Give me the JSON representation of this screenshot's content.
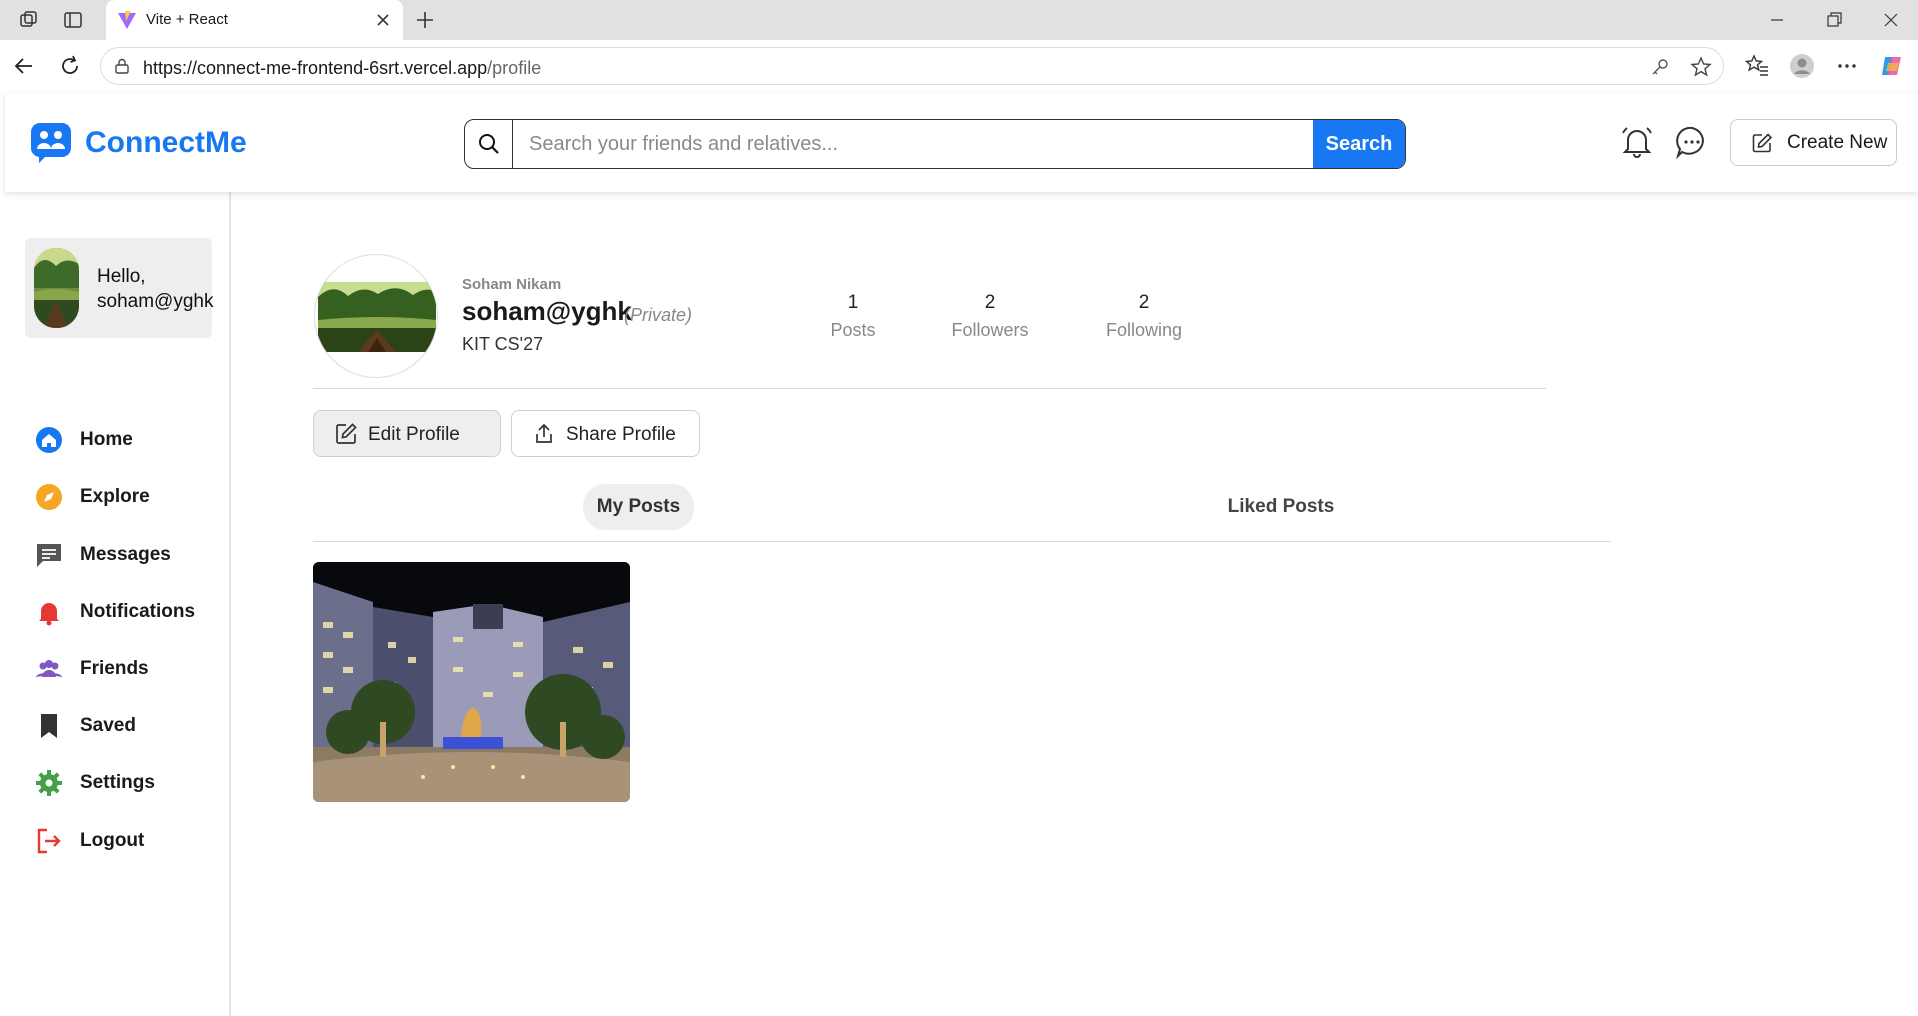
{
  "browser": {
    "tab_title": "Vite + React",
    "url_host": "https://connect-me-frontend-6srt.vercel.app",
    "url_path": "/profile"
  },
  "app": {
    "brand": "ConnectMe",
    "brand_color": "#1877f2",
    "search": {
      "placeholder": "Search your friends and relatives...",
      "button_label": "Search"
    },
    "create_label": "Create New"
  },
  "sidebar": {
    "greeting": "Hello,",
    "user_handle": "soham@yghk",
    "items": [
      {
        "label": "Home",
        "icon": "home-icon",
        "color": "#1877f2"
      },
      {
        "label": "Explore",
        "icon": "compass-icon",
        "color": "#f5a623"
      },
      {
        "label": "Messages",
        "icon": "message-icon",
        "color": "#555555"
      },
      {
        "label": "Notifications",
        "icon": "bell-icon",
        "color": "#e53935"
      },
      {
        "label": "Friends",
        "icon": "friends-icon",
        "color": "#7e57c2"
      },
      {
        "label": "Saved",
        "icon": "bookmark-icon",
        "color": "#333333"
      },
      {
        "label": "Settings",
        "icon": "gear-icon",
        "color": "#43a047"
      },
      {
        "label": "Logout",
        "icon": "logout-icon",
        "color": "#e53935"
      }
    ]
  },
  "profile": {
    "full_name": "Soham Nikam",
    "username": "soham@yghk",
    "privacy": "(Private)",
    "bio": "KIT CS'27",
    "stats": [
      {
        "value": "1",
        "label": "Posts"
      },
      {
        "value": "2",
        "label": "Followers"
      },
      {
        "value": "2",
        "label": "Following"
      }
    ],
    "edit_label": "Edit Profile",
    "share_label": "Share Profile",
    "tabs": {
      "my_posts": "My Posts",
      "liked_posts": "Liked Posts"
    }
  }
}
